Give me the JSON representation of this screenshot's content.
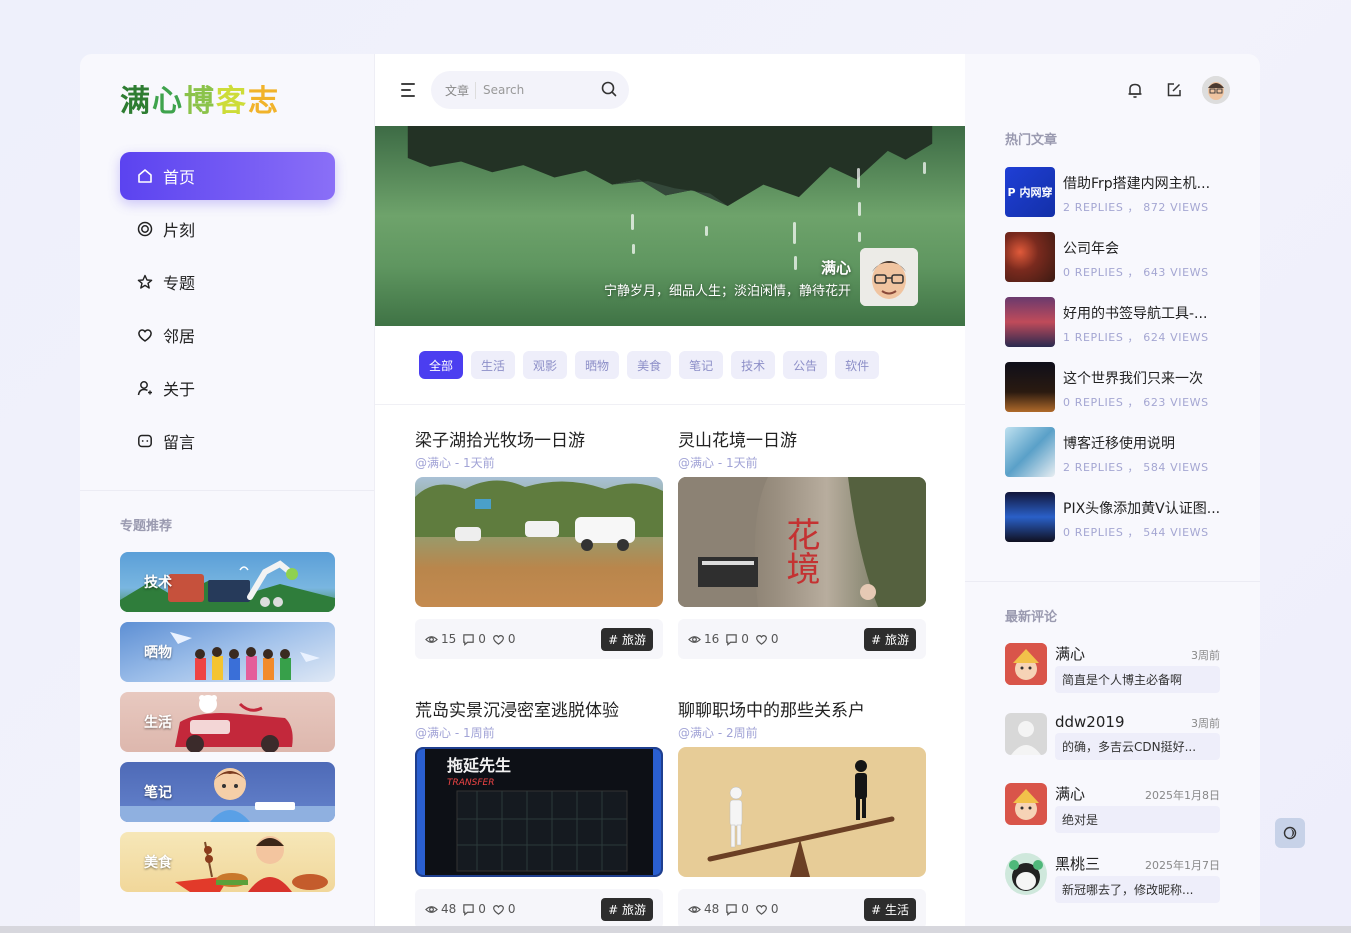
{
  "logo": {
    "chars": [
      "满",
      "心",
      "博",
      "客",
      "志"
    ]
  },
  "nav": [
    {
      "label": "首页",
      "icon": "home-icon",
      "active": true
    },
    {
      "label": "片刻",
      "icon": "target-icon"
    },
    {
      "label": "专题",
      "icon": "star-icon"
    },
    {
      "label": "邻居",
      "icon": "heart-icon"
    },
    {
      "label": "关于",
      "icon": "user-icon"
    },
    {
      "label": "留言",
      "icon": "chat-icon"
    }
  ],
  "topics": {
    "title": "专题推荐",
    "items": [
      "技术",
      "晒物",
      "生活",
      "笔记",
      "美食"
    ]
  },
  "search": {
    "category": "文章",
    "placeholder": "Search"
  },
  "banner": {
    "name": "满心",
    "motto": "宁静岁月，细品人生；淡泊闲情，静待花开"
  },
  "tabs": [
    "全部",
    "生活",
    "观影",
    "晒物",
    "美食",
    "笔记",
    "技术",
    "公告",
    "软件"
  ],
  "posts": [
    {
      "title": "梁子湖拾光牧场一日游",
      "meta": "@满心 - 1天前",
      "views": "15",
      "comments": "0",
      "likes": "0",
      "tag": "# 旅游"
    },
    {
      "title": "灵山花境一日游",
      "meta": "@满心 - 1天前",
      "views": "16",
      "comments": "0",
      "likes": "0",
      "tag": "# 旅游"
    },
    {
      "title": "荒岛实景沉浸密室逃脱体验",
      "meta": "@满心 - 1周前",
      "views": "48",
      "comments": "0",
      "likes": "0",
      "tag": "# 旅游"
    },
    {
      "title": "聊聊职场中的那些关系户",
      "meta": "@满心 - 2周前",
      "views": "48",
      "comments": "0",
      "likes": "0",
      "tag": "# 生活"
    }
  ],
  "hot": {
    "title": "热门文章",
    "items": [
      {
        "name": "借助Frp搭建内网主机...",
        "stat": "2 REPLIES ， 872 VIEWS",
        "thumb_text": "P 内网穿"
      },
      {
        "name": "公司年会",
        "stat": "0 REPLIES ， 643 VIEWS"
      },
      {
        "name": "好用的书签导航工具-...",
        "stat": "1 REPLIES ， 624 VIEWS"
      },
      {
        "name": "这个世界我们只来一次",
        "stat": "0 REPLIES ， 623 VIEWS"
      },
      {
        "name": "博客迁移使用说明",
        "stat": "2 REPLIES ， 584 VIEWS"
      },
      {
        "name": "PIX头像添加黄V认证图...",
        "stat": "0 REPLIES ， 544 VIEWS"
      }
    ]
  },
  "comments": {
    "title": "最新评论",
    "items": [
      {
        "user": "满心",
        "time": "3周前",
        "text": "简直是个人博主必备啊"
      },
      {
        "user": "ddw2019",
        "time": "3周前",
        "text": "的确，多吉云CDN挺好..."
      },
      {
        "user": "满心",
        "time": "2025年1月8日",
        "text": "绝对是"
      },
      {
        "user": "黑桃三",
        "time": "2025年1月7日",
        "text": "新冠哪去了，修改昵称..."
      }
    ]
  },
  "post_images_text": {
    "escape_sign": "拖延先生",
    "escape_sub": "TRANSFER",
    "flower_sign": "花境"
  }
}
